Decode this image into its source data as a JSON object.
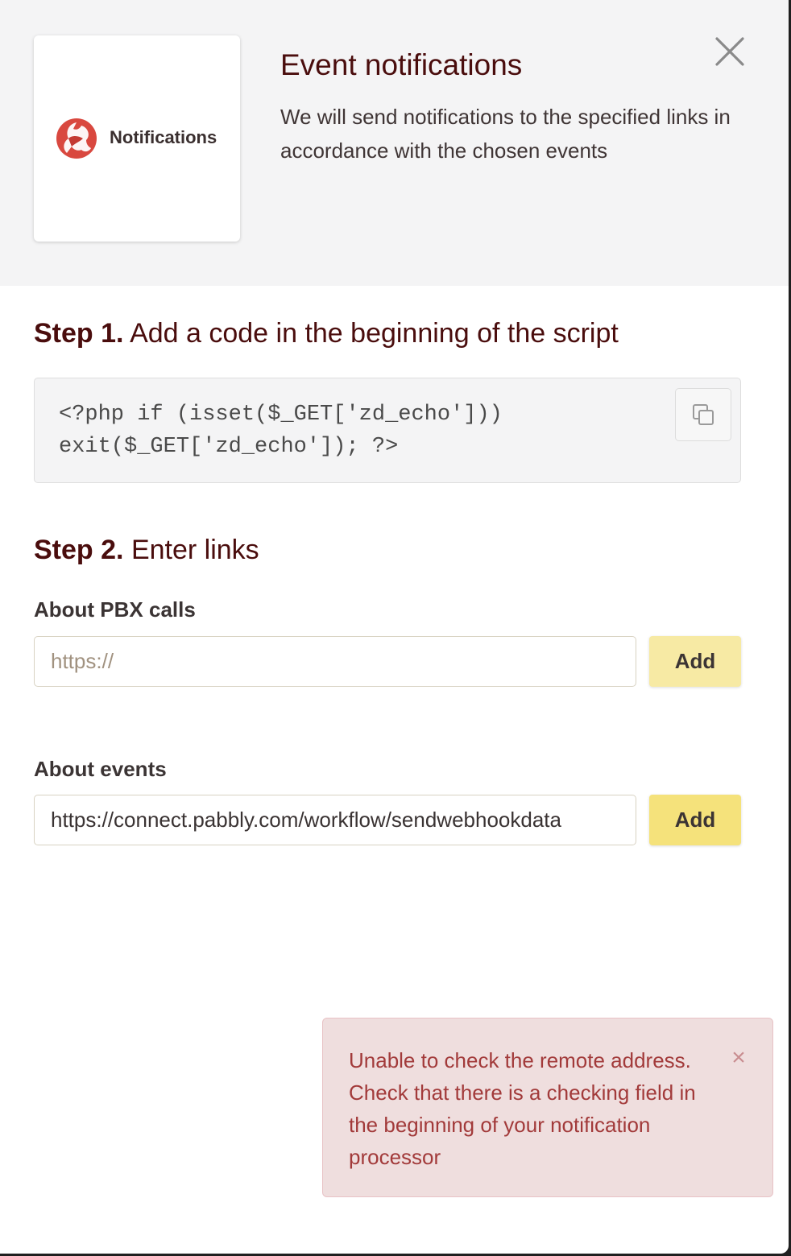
{
  "header": {
    "logo_text": "Notifications",
    "title": "Event notifications",
    "subtitle": "We will send notifications to the specified links in accordance with the chosen events"
  },
  "step1": {
    "prefix": "Step 1.",
    "text": "Add a code in the beginning of the script",
    "code": "<?php if (isset($_GET['zd_echo']))\nexit($_GET['zd_echo']); ?>"
  },
  "step2": {
    "prefix": "Step 2.",
    "text": "Enter links"
  },
  "pbx_calls": {
    "label": "About PBX calls",
    "placeholder": "https://",
    "value": "",
    "button": "Add"
  },
  "events": {
    "label": "About events",
    "placeholder": "https://",
    "value": "https://connect.pabbly.com/workflow/sendwebhookdata",
    "button": "Add"
  },
  "alert": {
    "message": "Unable to check the remote address. Check that there is a checking field in the beginning of your notification processor",
    "close_glyph": "×"
  },
  "colors": {
    "brand_red": "#d9483f",
    "title": "#4a0d0d",
    "add_button": "#f5e27b",
    "alert_bg": "#efdede",
    "alert_text": "#a23a3a"
  },
  "icons": {
    "logo": "notifications-logo-icon",
    "close": "close-icon",
    "copy": "copy-icon"
  }
}
